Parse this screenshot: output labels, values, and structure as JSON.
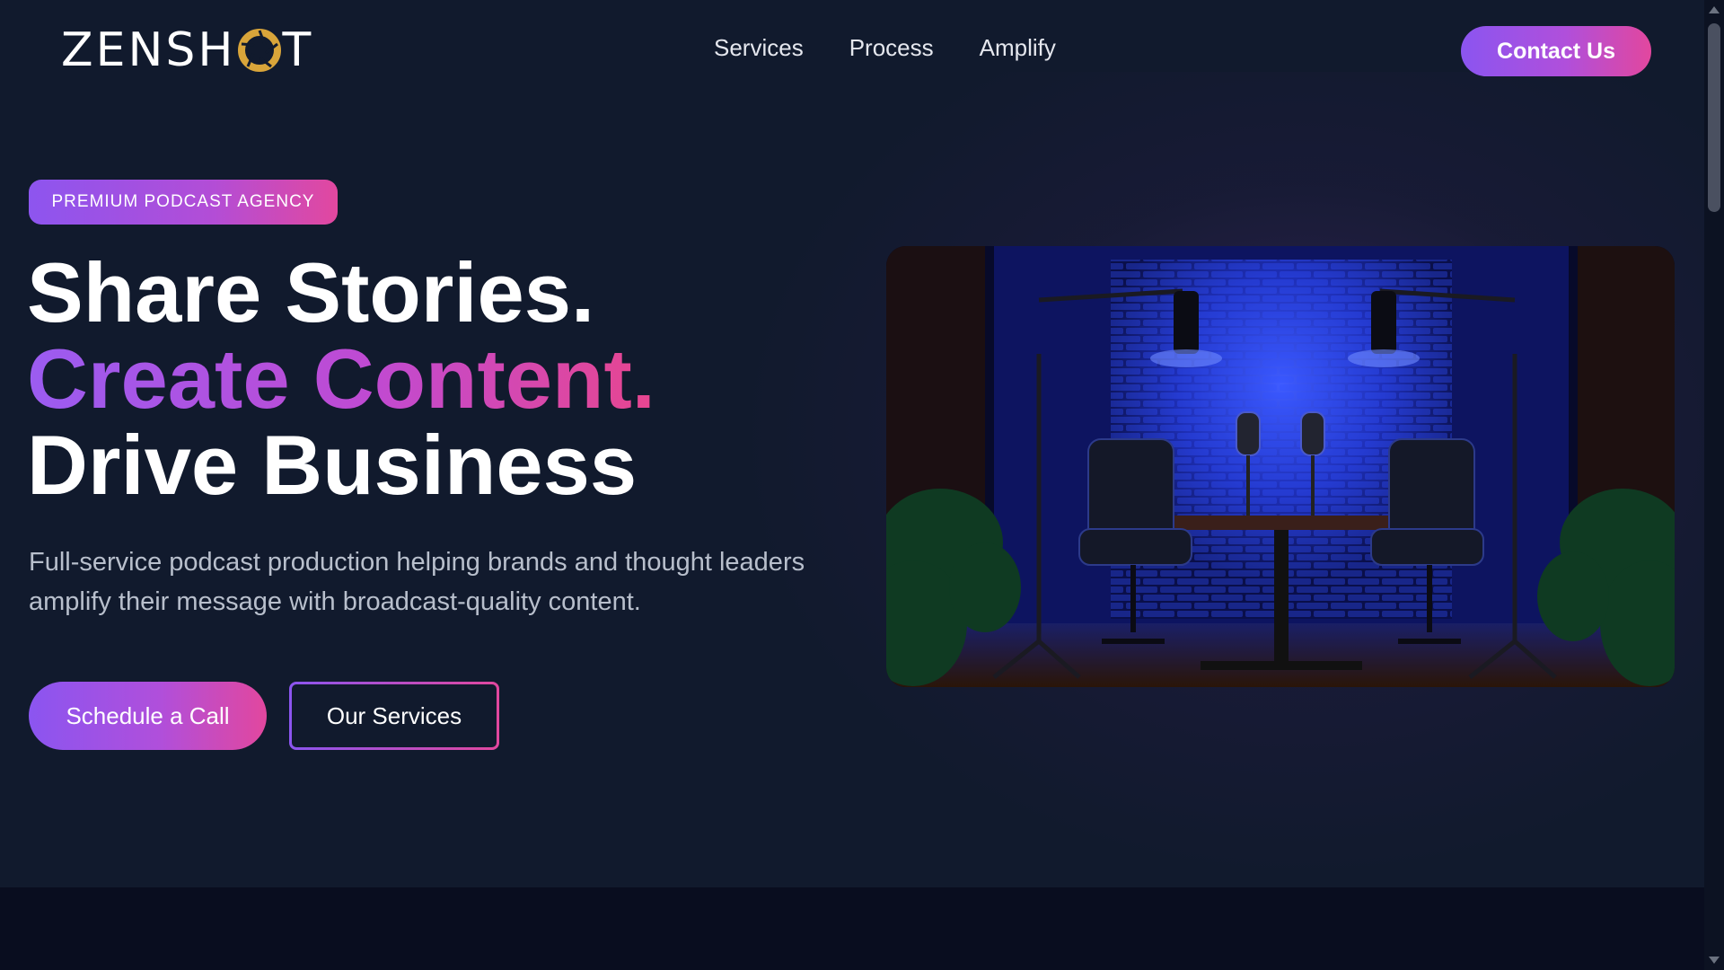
{
  "header": {
    "logo_text_left": "ZENSH",
    "logo_text_right": "T",
    "logo_icon": "aperture-icon",
    "nav": [
      {
        "label": "Services"
      },
      {
        "label": "Process"
      },
      {
        "label": "Amplify"
      }
    ],
    "contact_label": "Contact Us"
  },
  "hero": {
    "badge": "PREMIUM PODCAST AGENCY",
    "headline": {
      "line1": "Share Stories.",
      "line2": "Create Content.",
      "line3": "Drive Business"
    },
    "subtext": "Full-service podcast production helping brands and thought leaders amplify their message with broadcast-quality content.",
    "primary_cta": "Schedule a Call",
    "secondary_cta": "Our Services",
    "image_subject": "podcast-studio-photo"
  },
  "colors": {
    "background": "#111a2d",
    "accent_purple": "#8b55f0",
    "accent_pink": "#e2479e",
    "logo_gold": "#d9a53a"
  }
}
